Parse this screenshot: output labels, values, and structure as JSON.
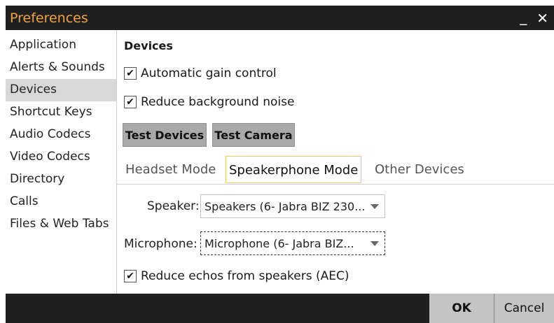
{
  "window": {
    "title": "Preferences",
    "minimize_icon": "minimize-icon",
    "close_icon": "close-icon",
    "minimize_glyph": "_",
    "close_glyph": "✕"
  },
  "sidebar": {
    "items": [
      {
        "label": "Application",
        "active": false
      },
      {
        "label": "Alerts & Sounds",
        "active": false
      },
      {
        "label": "Devices",
        "active": true
      },
      {
        "label": "Shortcut Keys",
        "active": false
      },
      {
        "label": "Audio Codecs",
        "active": false
      },
      {
        "label": "Video Codecs",
        "active": false
      },
      {
        "label": "Directory",
        "active": false
      },
      {
        "label": "Calls",
        "active": false
      },
      {
        "label": "Files & Web Tabs",
        "active": false
      }
    ]
  },
  "main": {
    "section_title": "Devices",
    "agc": {
      "label": "Automatic gain control",
      "checked": true
    },
    "noise": {
      "label": "Reduce background noise",
      "checked": true
    },
    "test_devices_label": "Test Devices",
    "test_camera_label": "Test Camera",
    "tabs": [
      {
        "label": "Headset Mode",
        "active": false
      },
      {
        "label": "Speakerphone Mode",
        "active": true
      },
      {
        "label": "Other Devices",
        "active": false
      }
    ],
    "speaker": {
      "label": "Speaker:",
      "value": "Speakers (6- Jabra BIZ 230..."
    },
    "microphone": {
      "label": "Microphone:",
      "value": "Microphone (6- Jabra BIZ..."
    },
    "aec": {
      "label": "Reduce echos from speakers (AEC)",
      "checked": true
    },
    "check_glyph": "✔"
  },
  "footer": {
    "ok_label": "OK",
    "cancel_label": "Cancel"
  },
  "colors": {
    "title_text": "#f2a33a",
    "titlebar_bg": "#1f1f1f",
    "button_bg": "#a9a9a9",
    "active_tab_border": "#f0c96a"
  }
}
